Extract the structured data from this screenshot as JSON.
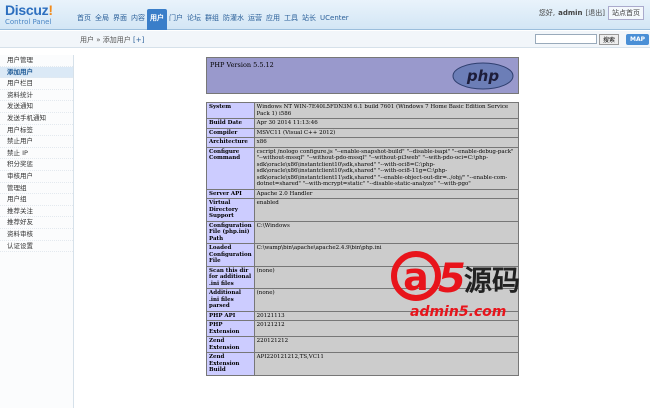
{
  "header": {
    "logo_main": "Discuz",
    "logo_bang": "!",
    "logo_sub": "Control Panel",
    "nav": [
      "首页",
      "全局",
      "界面",
      "内容",
      "用户",
      "门户",
      "论坛",
      "群组",
      "防灌水",
      "运营",
      "应用",
      "工具",
      "站长",
      "UCenter"
    ],
    "nav_active_index": 4,
    "greeting": "您好,",
    "username": "admin",
    "logout": "[退出]",
    "home_button": "站点首页"
  },
  "subbar": {
    "crumb_root": "用户",
    "crumb_sep": "»",
    "crumb_current": "添加用户",
    "crumb_add": "[+]",
    "search_placeholder": "",
    "search_button": "搜索",
    "map_button": "MAP"
  },
  "sidebar": {
    "items": [
      "用户管理",
      "添加用户",
      "用户栏目",
      "资料统计",
      "发送通知",
      "发送手机通知",
      "用户标签",
      "禁止用户",
      "禁止 IP",
      "积分奖惩",
      "审核用户",
      "管理组",
      "用户组",
      "推荐关注",
      "推荐好友",
      "资料审核",
      "认证设置"
    ],
    "active_index": 1
  },
  "phpinfo": {
    "version": "PHP Version 5.5.12",
    "logo_text": "php",
    "rows": [
      {
        "k": "System",
        "v": "Windows NT WIN-7E40L5FDN3M 6.1 build 7601 (Windows 7 Home Basic Edition Service Pack 1) i586"
      },
      {
        "k": "Build Date",
        "v": "Apr 30 2014 11:13:46"
      },
      {
        "k": "Compiler",
        "v": "MSVC11 (Visual C++ 2012)"
      },
      {
        "k": "Architecture",
        "v": "x86"
      },
      {
        "k": "Configure Command",
        "v": "cscript /nologo configure.js \"--enable-snapshot-build\" \"--disable-isapi\" \"--enable-debug-pack\" \"--without-mssql\" \"--without-pdo-mssql\" \"--without-pi3web\" \"--with-pdo-oci=C:\\php-sdk\\oracle\\x86\\instantclient10\\sdk,shared\" \"--with-oci8=C:\\php-sdk\\oracle\\x86\\instantclient10\\sdk,shared\" \"--with-oci8-11g=C:\\php-sdk\\oracle\\x86\\instantclient11\\sdk,shared\" \"--enable-object-out-dir=../obj/\" \"--enable-com-dotnet=shared\" \"--with-mcrypt=static\" \"--disable-static-analyze\" \"--with-pgo\""
      },
      {
        "k": "Server API",
        "v": "Apache 2.0 Handler"
      },
      {
        "k": "Virtual Directory Support",
        "v": "enabled"
      },
      {
        "k": "Configuration File (php.ini) Path",
        "v": "C:\\Windows"
      },
      {
        "k": "Loaded Configuration File",
        "v": "C:\\wamp\\bin\\apache\\apache2.4.9\\bin\\php.ini"
      },
      {
        "k": "Scan this dir for additional .ini files",
        "v": "(none)"
      },
      {
        "k": "Additional .ini files parsed",
        "v": "(none)"
      },
      {
        "k": "PHP API",
        "v": "20121113"
      },
      {
        "k": "PHP Extension",
        "v": "20121212"
      },
      {
        "k": "Zend Extension",
        "v": "220121212"
      },
      {
        "k": "Zend Extension Build",
        "v": "API220121212,TS,VC11"
      }
    ]
  },
  "watermark": {
    "a": "a",
    "five": "5",
    "cn": "源码",
    "url": "admin5.com"
  },
  "colors": {
    "nav_active": "#3a7ec9",
    "php_header": "#9999cc",
    "php_key": "#ccccff",
    "php_val": "#cccccc",
    "watermark_red": "#e8141b"
  }
}
